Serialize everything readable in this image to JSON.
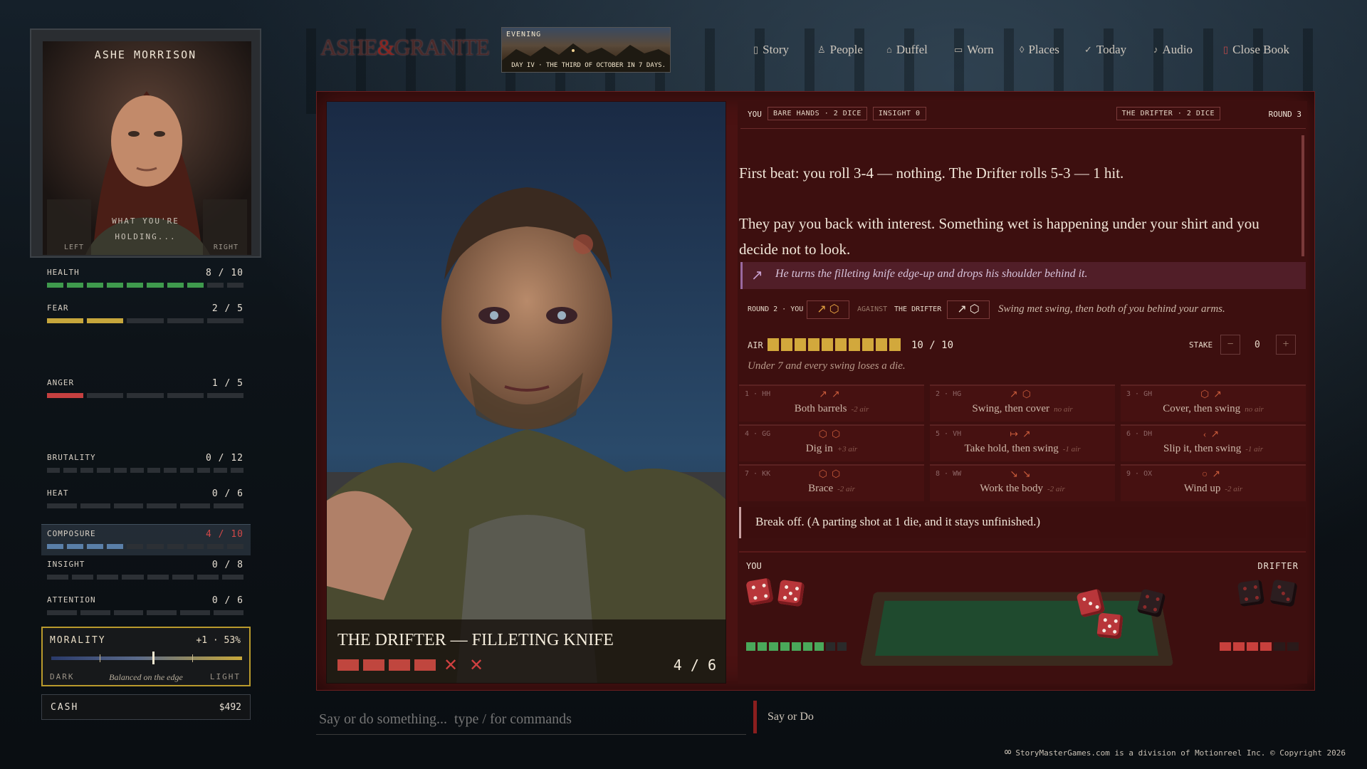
{
  "character": {
    "name": "ASHE MORRISON",
    "holding_label": "WHAT YOU'RE HOLDING...",
    "left_hand": "LEFT",
    "right_hand": "RIGHT"
  },
  "stats": [
    {
      "label": "HEALTH",
      "value": "8 / 10",
      "current": 8,
      "max": 10,
      "color": "#3f9a4d"
    },
    {
      "label": "FEAR",
      "value": "2 / 5",
      "current": 2,
      "max": 5,
      "color": "#c6a63c"
    },
    {
      "label": "ANGER",
      "value": "1 / 5",
      "current": 1,
      "max": 5,
      "color": "#c54040"
    },
    {
      "label": "BRUTALITY",
      "value": "0 / 12",
      "current": 0,
      "max": 12,
      "color": "#888"
    },
    {
      "label": "HEAT",
      "value": "0 / 6",
      "current": 0,
      "max": 6,
      "color": "#888"
    },
    {
      "label": "COMPOSURE",
      "value": "4 / 10",
      "current": 4,
      "max": 10,
      "color": "#5a7fa8",
      "value_color": "#d14848"
    },
    {
      "label": "INSIGHT",
      "value": "0 / 8",
      "current": 0,
      "max": 8,
      "color": "#888"
    },
    {
      "label": "ATTENTION",
      "value": "0 / 6",
      "current": 0,
      "max": 6,
      "color": "#888"
    }
  ],
  "morality": {
    "label": "MORALITY",
    "value": "+1 · 53%",
    "level": 0.53,
    "left": "DARK",
    "right": "LIGHT",
    "caption": "Balanced on the edge"
  },
  "cash": {
    "label": "CASH",
    "value": "$492"
  },
  "header": {
    "logo_a": "ASHE",
    "logo_amp": "&",
    "logo_b": "GRANITE",
    "time_of_day": "EVENING",
    "day_line": "DAY IV · THE THIRD OF OCTOBER IN 7 DAYS."
  },
  "nav": [
    {
      "label": "Story",
      "icon": "book-icon",
      "glyph": "▯"
    },
    {
      "label": "People",
      "icon": "person-icon",
      "glyph": "♙"
    },
    {
      "label": "Duffel",
      "icon": "bag-icon",
      "glyph": "⌂"
    },
    {
      "label": "Worn",
      "icon": "shirt-icon",
      "glyph": "▭"
    },
    {
      "label": "Places",
      "icon": "pin-icon",
      "glyph": "◊"
    },
    {
      "label": "Today",
      "icon": "check-icon",
      "glyph": "✓"
    },
    {
      "label": "Audio",
      "icon": "music-icon",
      "glyph": "♪"
    },
    {
      "label": "Close Book",
      "icon": "close-book-icon",
      "glyph": "▯",
      "accent": "#c24a4a"
    }
  ],
  "enemy": {
    "caption": "THE DRIFTER — FILLETING KNIFE",
    "health_value": "4 / 6",
    "filled": 4,
    "max": 6
  },
  "combat": {
    "you": "YOU",
    "tags": [
      "BARE HANDS · 2 DICE",
      "INSIGHT 0"
    ],
    "opponent_tag": "THE DRIFTER · 2 DICE",
    "round": "ROUND 3",
    "story_1": "First beat: you roll 3-4 — nothing. The Drifter rolls 5-3 — 1 hit.",
    "story_2": "They pay you back with interest. Something wet is happening under your shirt and you decide not to look.",
    "quote": "He turns the filleting knife edge-up and drops his shoulder behind it.",
    "history_round": "ROUND 2 · YOU",
    "history_against": "AGAINST",
    "history_opponent": "THE DRIFTER",
    "history_note": "Swing met swing, then both of you behind your arms.",
    "air_label": "AIR",
    "air_value": "10 / 10",
    "air_current": 10,
    "air_max": 10,
    "air_note": "Under 7 and every swing loses a die.",
    "stake_label": "STAKE",
    "stake_value": "0",
    "stake_minus": "−",
    "stake_plus": "+",
    "moves": [
      {
        "num": "1 · HH",
        "label": "Both barrels",
        "cost": "-2 air",
        "icons": "↗↗"
      },
      {
        "num": "2 · HG",
        "label": "Swing, then cover",
        "cost": "no air",
        "icons": "↗⬡"
      },
      {
        "num": "3 · GH",
        "label": "Cover, then swing",
        "cost": "no air",
        "icons": "⬡↗"
      },
      {
        "num": "4 · GG",
        "label": "Dig in",
        "cost": "+3 air",
        "icons": "⬡⬡"
      },
      {
        "num": "5 · VH",
        "label": "Take hold, then swing",
        "cost": "-1 air",
        "icons": "↦↗"
      },
      {
        "num": "6 · DH",
        "label": "Slip it, then swing",
        "cost": "-1 air",
        "icons": "‹↗"
      },
      {
        "num": "7 · KK",
        "label": "Brace",
        "cost": "-2 air",
        "icons": "⬡⬡"
      },
      {
        "num": "8 · WW",
        "label": "Work the body",
        "cost": "-2 air",
        "icons": "↘↘"
      },
      {
        "num": "9 · OX",
        "label": "Wind up",
        "cost": "-2 air",
        "icons": "○↗"
      }
    ],
    "break_off": "Break off. (A parting shot at 1 die, and it stays unfinished.)",
    "you_label": "YOU",
    "drifter_label": "DRIFTER",
    "you_air_filled": 7,
    "you_air_total": 9,
    "drifter_air_filled": 4,
    "drifter_air_total": 6
  },
  "input": {
    "placeholder": "Say or do something...  type / for commands",
    "mode": "Say or Do"
  },
  "footer": "StoryMasterGames.com is a division of  Motionreel Inc. © Copyright 2026"
}
